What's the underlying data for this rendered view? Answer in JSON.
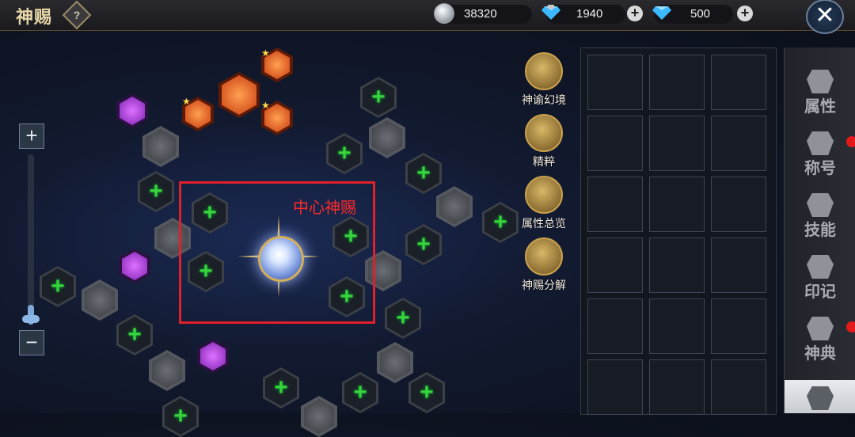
{
  "header": {
    "title": "神赐",
    "help_label": "?",
    "silver": "38320",
    "diamond_bound": "1940",
    "diamond": "500",
    "add_label": "+",
    "close_label": "✕"
  },
  "zoom": {
    "in_label": "+",
    "out_label": "−",
    "level": 0.1
  },
  "highlight_label": "中心神赐",
  "actions": [
    {
      "label": "神谕幻境",
      "icon": "tree-icon"
    },
    {
      "label": "精粹",
      "icon": "scroll-icon"
    },
    {
      "label": "属性总览",
      "icon": "scroll-icon"
    },
    {
      "label": "神赐分解",
      "icon": "swirl-icon"
    }
  ],
  "node_plus": "+",
  "sidebar": [
    {
      "label": "属性",
      "icon": "bag-icon",
      "badge": false
    },
    {
      "label": "称号",
      "icon": "chest-icon",
      "badge": true
    },
    {
      "label": "技能",
      "icon": "flame-book-icon",
      "badge": false
    },
    {
      "label": "印记",
      "icon": "seal-icon",
      "badge": false
    },
    {
      "label": "神典",
      "icon": "book-icon",
      "badge": true
    },
    {
      "label": "",
      "icon": "godgift-icon",
      "badge": false,
      "active": true
    }
  ],
  "colors": {
    "accent_red": "#e0202a",
    "plus_green": "#39d43c",
    "gold": "#d4b05a"
  }
}
